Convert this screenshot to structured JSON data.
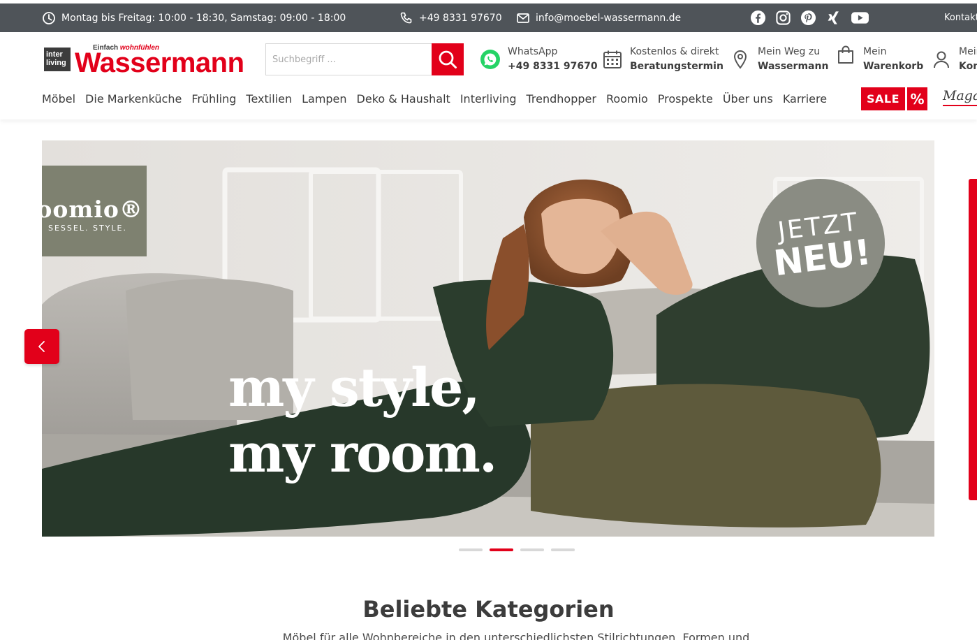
{
  "topbar": {
    "hours": "Montag bis Freitag: 10:00 - 18:30, Samstag: 09:00 - 18:00",
    "phone": "+49 8331 97670",
    "email": "info@moebel-wassermann.de",
    "social": [
      "facebook-icon",
      "instagram-icon",
      "pinterest-icon",
      "xing-icon",
      "youtube-icon"
    ],
    "kontakt": "Kontakt"
  },
  "logo": {
    "box": "inter living",
    "tagline_prefix": "Einfach ",
    "tagline_accent": "wohnfühlen",
    "name": "Wassermann"
  },
  "search": {
    "placeholder": "Suchbegriff ..."
  },
  "header_links": [
    {
      "title": "WhatsApp",
      "sub": "+49 8331 97670",
      "icon": "whatsapp-icon"
    },
    {
      "title": "Kostenlos & direkt",
      "sub": "Beratungstermin",
      "icon": "calendar-icon"
    },
    {
      "title": "Mein Weg zu",
      "sub": "Wassermann",
      "icon": "map-pin-icon"
    },
    {
      "title": "Mein",
      "sub": "Warenkorb",
      "icon": "shopping-bag-icon"
    },
    {
      "title": "Mein",
      "sub": "Konto",
      "icon": "user-icon"
    }
  ],
  "nav": [
    "Möbel",
    "Die Markenküche",
    "Frühling",
    "Textilien",
    "Lampen",
    "Deko & Haushalt",
    "Interliving",
    "Trendhopper",
    "Roomio",
    "Prospekte",
    "Über uns",
    "Karriere"
  ],
  "sale": {
    "label": "SALE",
    "symbol": "%"
  },
  "magazin": "Magazin",
  "hero": {
    "brand": "roomio®",
    "brand_tag": "SESSEL. STYLE.",
    "badge_line1": "JETZT",
    "badge_line2": "NEU!",
    "headline_line1": "my style,",
    "headline_line2": "my room.",
    "active_slide": 2,
    "slide_count": 4
  },
  "categories": {
    "title": "Beliebte Kategorien",
    "text": "Möbel für alle Wohnbereiche in den unterschiedlichsten Stilrichtungen, Formen und"
  },
  "colors": {
    "brand_red": "#e2001a",
    "topbar_bg": "#4f5459",
    "text": "#3c3c3c"
  }
}
